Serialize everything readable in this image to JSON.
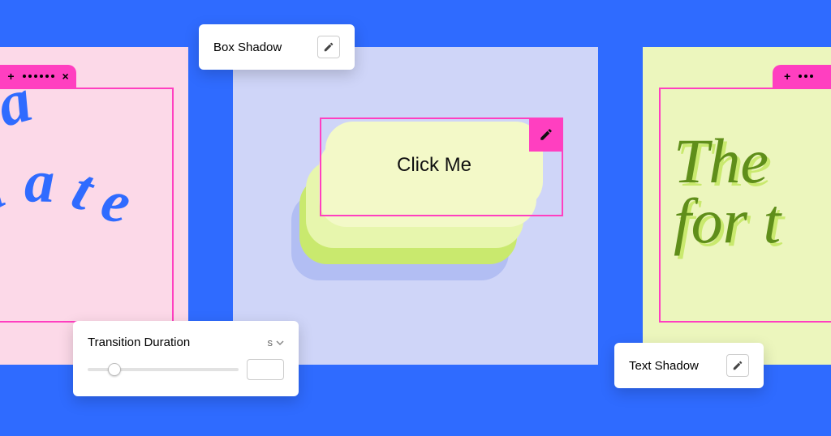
{
  "colors": {
    "bg": "#2f6bff",
    "pink_panel": "#fcd9e8",
    "lilac_panel": "#cfd5f8",
    "green_panel": "#ecf6bd",
    "magenta": "#ff3fc0",
    "blue_text": "#2f6bff",
    "olive_text": "#5f8e1a"
  },
  "left_panel": {
    "wavy_text": "i a\nmate"
  },
  "center_panel": {
    "button_label": "Click Me"
  },
  "right_panel": {
    "serif_text": "The\nfor t"
  },
  "cards": {
    "box_shadow": {
      "label": "Box Shadow"
    },
    "transition": {
      "label": "Transition Duration",
      "unit": "s",
      "slider_percent": 18
    },
    "text_shadow": {
      "label": "Text Shadow"
    }
  }
}
